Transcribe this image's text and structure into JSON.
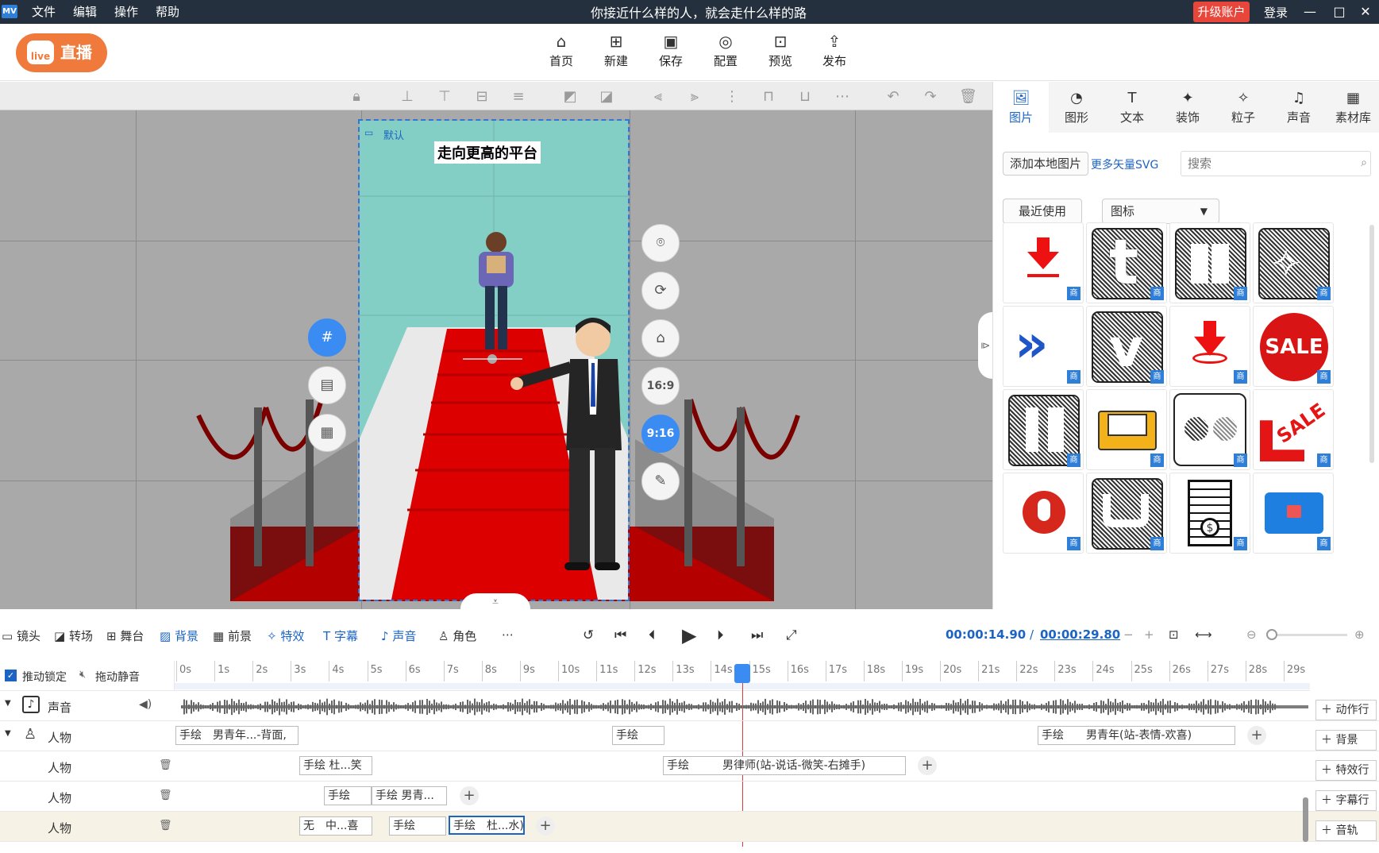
{
  "app": {
    "logo": "MV",
    "title": "你接近什么样的人，就会走什么样的路",
    "menu": [
      "文件",
      "编辑",
      "操作",
      "帮助"
    ],
    "upgrade": "升级账户",
    "login": "登录"
  },
  "live_label": "直播",
  "live_icon_text": "live",
  "toolbar": [
    {
      "icon": "home-icon",
      "label": "首页"
    },
    {
      "icon": "new-icon",
      "label": "新建"
    },
    {
      "icon": "save-icon",
      "label": "保存"
    },
    {
      "icon": "config-icon",
      "label": "配置"
    },
    {
      "icon": "preview-icon",
      "label": "预览"
    },
    {
      "icon": "publish-icon",
      "label": "发布"
    }
  ],
  "scene": {
    "camera_label": "默认",
    "headline": "走向更高的平台"
  },
  "side_controls": {
    "ratio_16_9": "16:9",
    "ratio_9_16": "9:16"
  },
  "panel": {
    "tabs": [
      {
        "icon": "image-icon",
        "label": "图片"
      },
      {
        "icon": "shape-icon",
        "label": "图形"
      },
      {
        "icon": "text-icon",
        "label": "文本"
      },
      {
        "icon": "decor-icon",
        "label": "装饰"
      },
      {
        "icon": "particle-icon",
        "label": "粒子"
      },
      {
        "icon": "sound-icon",
        "label": "声音"
      },
      {
        "icon": "library-icon",
        "label": "素材库"
      }
    ],
    "add_local": "添加本地图片",
    "more_svg": "更多矢量SVG",
    "search_placeholder": "搜索",
    "recent": "最近使用",
    "category": "图标",
    "badge": "商",
    "sale_text": "SALE"
  },
  "timeline": {
    "tools": [
      "镜头",
      "转场",
      "舞台",
      "背景",
      "前景",
      "特效",
      "字幕",
      "声音",
      "角色"
    ],
    "current": "00:00:14.90",
    "separator": "/",
    "total": "00:00:29.80",
    "lock": "推动锁定",
    "mute": "拖动静音",
    "ticks": [
      "0s",
      "1s",
      "2s",
      "3s",
      "4s",
      "5s",
      "6s",
      "7s",
      "8s",
      "9s",
      "10s",
      "11s",
      "12s",
      "13s",
      "14s",
      "15s",
      "16s",
      "17s",
      "18s",
      "19s",
      "20s",
      "21s",
      "22s",
      "23s",
      "24s",
      "25s",
      "26s",
      "27s",
      "28s",
      "29s"
    ],
    "rows": {
      "sound": "声音",
      "person": "人物"
    },
    "clips": {
      "r1a_tag": "手绘",
      "r1a": "男青年...-背面,",
      "r1b_tag": "手绘",
      "r1c_tag": "手绘",
      "r1c": "男青年(站-表情-欢喜)",
      "r2a_tag": "手绘",
      "r2a": "杜...笑",
      "r2b_tag": "手绘",
      "r2b": "男律师(站-说话-微笑-右摊手)",
      "r3a_tag": "手绘",
      "r3b_tag": "手绘",
      "r3b": "男青...",
      "r4a_tag": "无",
      "r4a": "中...喜",
      "r4b_tag": "手绘",
      "r4c_tag": "手绘",
      "r4c": "杜...水)"
    },
    "right_buttons": [
      "动作行",
      "背景",
      "特效行",
      "字幕行",
      "音轨"
    ]
  }
}
